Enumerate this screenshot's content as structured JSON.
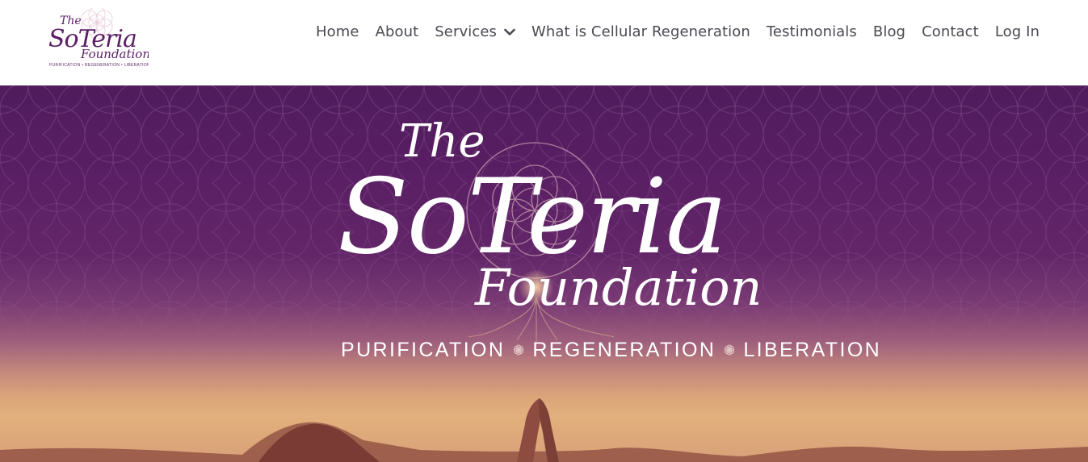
{
  "brand": {
    "logo_line1": "The",
    "logo_line2": "SoTeria",
    "logo_line3": "Foundation",
    "logo_tagline": "PURIFICATION • REGENERATION • LIBERATION",
    "accent_color": "#5b1e66"
  },
  "nav": {
    "items": [
      {
        "label": "Home"
      },
      {
        "label": "About"
      },
      {
        "label": "Services",
        "icon": "chevron-down-icon"
      },
      {
        "label": "What is Cellular Regeneration"
      },
      {
        "label": "Testimonials"
      },
      {
        "label": "Blog"
      },
      {
        "label": "Contact"
      },
      {
        "label": "Log In"
      }
    ]
  },
  "hero": {
    "title_the": "The",
    "title_main": "SoTeria",
    "title_sub": "Foundation",
    "tagline": [
      "PURIFICATION",
      "REGENERATION",
      "LIBERATION"
    ],
    "separator_icon": "flower-of-life-icon",
    "background_top": "#4f1c5c",
    "background_bottom": "#e2b07c"
  }
}
